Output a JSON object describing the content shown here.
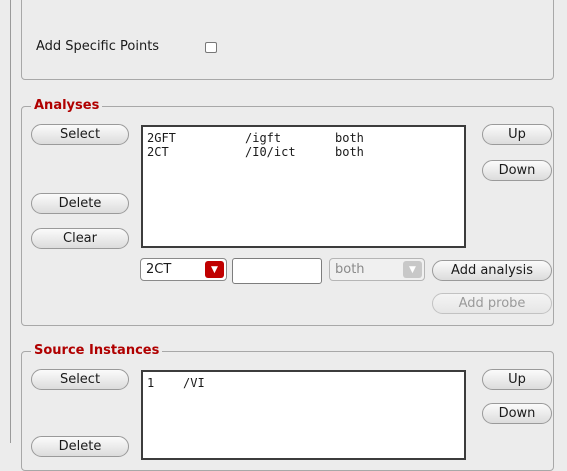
{
  "top_section": {
    "add_specific_points_label": "Add Specific Points",
    "add_specific_points_checked": false
  },
  "analyses": {
    "title": "Analyses",
    "select_label": "Select",
    "delete_label": "Delete",
    "clear_label": "Clear",
    "up_label": "Up",
    "down_label": "Down",
    "rows": [
      {
        "name": "2GFT",
        "path": "/igft",
        "mode": "both"
      },
      {
        "name": "2CT",
        "path": "/I0/ict",
        "mode": "both"
      }
    ],
    "analysis_select_value": "2CT",
    "text_field_value": "",
    "mode_select_value": "both",
    "add_analysis_label": "Add analysis",
    "add_probe_label": "Add probe"
  },
  "source_instances": {
    "title": "Source Instances",
    "select_label": "Select",
    "delete_label": "Delete",
    "up_label": "Up",
    "down_label": "Down",
    "rows": [
      {
        "index": "1",
        "path": "/VI"
      }
    ]
  },
  "colors": {
    "legend_red": "#b00000",
    "combo_arrow_red": "#c00000",
    "combo_arrow_gray": "#c8c8c8"
  },
  "icons": {
    "dropdown_arrow": "chevron-down-icon"
  }
}
